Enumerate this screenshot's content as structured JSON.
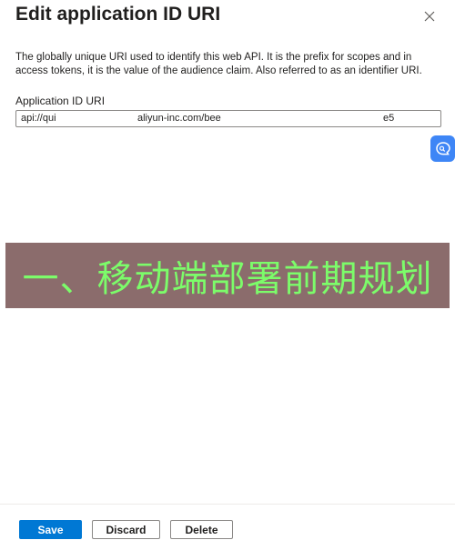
{
  "dialog": {
    "title": "Edit application ID URI",
    "close_icon": "close-icon",
    "description": "The globally unique URI used to identify this web API. It is the prefix for scopes and in access tokens, it is the value of the audience claim. Also referred to as an identifier URI."
  },
  "field": {
    "label": "Application ID URI",
    "value_part1": "api://qui",
    "value_part2": "aliyun-inc.com/bee",
    "value_part3": " e5"
  },
  "floating": {
    "icon": "chat-assistant-icon",
    "color": "#3e86f6"
  },
  "banner": {
    "text": "一、移动端部署前期规划",
    "background": "#8b6c6c",
    "text_color": "#7cfc6a"
  },
  "footer": {
    "save_label": "Save",
    "discard_label": "Discard",
    "delete_label": "Delete",
    "accent": "#0078d4"
  }
}
